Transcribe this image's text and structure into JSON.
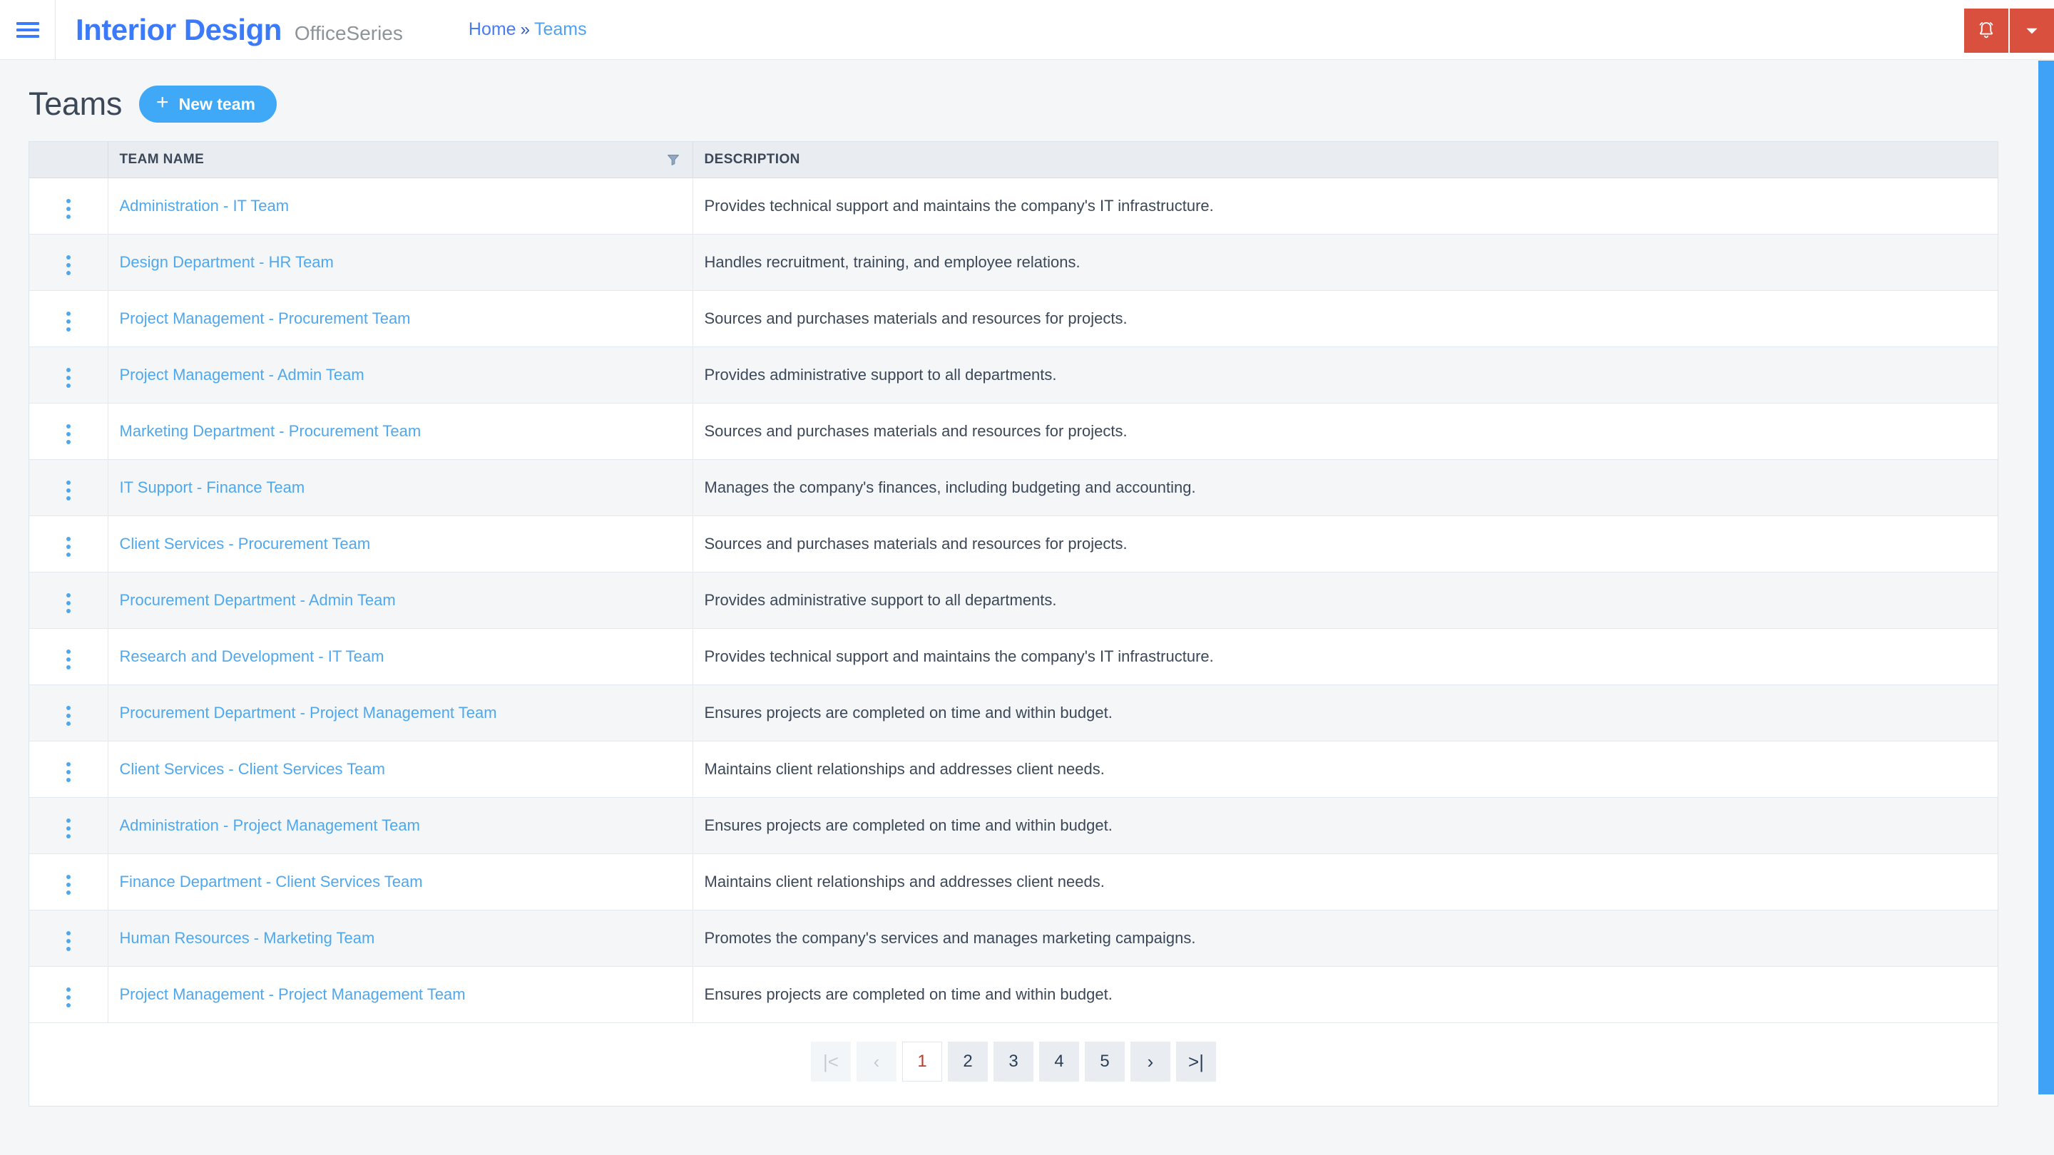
{
  "topbar": {
    "menu_icon": "hamburger-icon",
    "brand": "Interior Design",
    "brand_sub": "OfficeSeries",
    "breadcrumb": {
      "home": "Home",
      "separator": "»",
      "current": "Teams"
    },
    "notification_icon": "bell-icon",
    "caret_icon": "chevron-down-icon",
    "accent_color": "#d9503f"
  },
  "page": {
    "title": "Teams",
    "new_button": {
      "label": "New team",
      "icon": "plus-icon",
      "color": "#40a9f7"
    }
  },
  "table": {
    "columns": [
      "",
      "TEAM NAME",
      "DESCRIPTION"
    ],
    "filter_icon": "filter-icon",
    "row_action_icon": "kebab-menu-icon",
    "link_color": "#4fa8ee",
    "rows": [
      {
        "name": "Administration - IT Team",
        "description": "Provides technical support and maintains the company's IT infrastructure."
      },
      {
        "name": "Design Department - HR Team",
        "description": "Handles recruitment, training, and employee relations."
      },
      {
        "name": "Project Management - Procurement Team",
        "description": "Sources and purchases materials and resources for projects."
      },
      {
        "name": "Project Management - Admin Team",
        "description": "Provides administrative support to all departments."
      },
      {
        "name": "Marketing Department - Procurement Team",
        "description": "Sources and purchases materials and resources for projects."
      },
      {
        "name": "IT Support - Finance Team",
        "description": "Manages the company's finances, including budgeting and accounting."
      },
      {
        "name": "Client Services - Procurement Team",
        "description": "Sources and purchases materials and resources for projects."
      },
      {
        "name": "Procurement Department - Admin Team",
        "description": "Provides administrative support to all departments."
      },
      {
        "name": "Research and Development - IT Team",
        "description": "Provides technical support and maintains the company's IT infrastructure."
      },
      {
        "name": "Procurement Department - Project Management Team",
        "description": "Ensures projects are completed on time and within budget."
      },
      {
        "name": "Client Services - Client Services Team",
        "description": "Maintains client relationships and addresses client needs."
      },
      {
        "name": "Administration - Project Management Team",
        "description": "Ensures projects are completed on time and within budget."
      },
      {
        "name": "Finance Department - Client Services Team",
        "description": "Maintains client relationships and addresses client needs."
      },
      {
        "name": "Human Resources - Marketing Team",
        "description": "Promotes the company's services and manages marketing campaigns."
      },
      {
        "name": "Project Management - Project Management Team",
        "description": "Ensures projects are completed on time and within budget."
      }
    ]
  },
  "pagination": {
    "first_label": "|<",
    "prev_label": "‹",
    "pages": [
      "1",
      "2",
      "3",
      "4",
      "5"
    ],
    "active_page": "1",
    "next_label": "›",
    "last_label": ">|",
    "active_color": "#c0392b"
  }
}
